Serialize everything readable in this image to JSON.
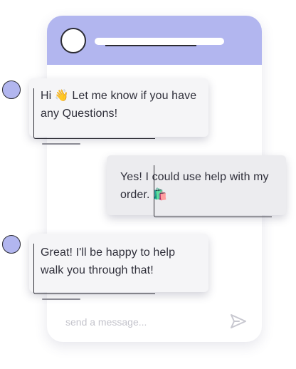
{
  "messages": [
    {
      "sender": "agent",
      "text": "Hi 👋 Let me know if you have any Questions!"
    },
    {
      "sender": "user",
      "text": "Yes! I could use help with my order. 🛍️"
    },
    {
      "sender": "agent",
      "text": "Great! I'll be happy to help walk you through that!"
    }
  ],
  "composer": {
    "placeholder": "send a message..."
  },
  "colors": {
    "header": "#b2b6ef",
    "bubble": "#f5f5f7",
    "avatar": "#b2b6ef"
  }
}
